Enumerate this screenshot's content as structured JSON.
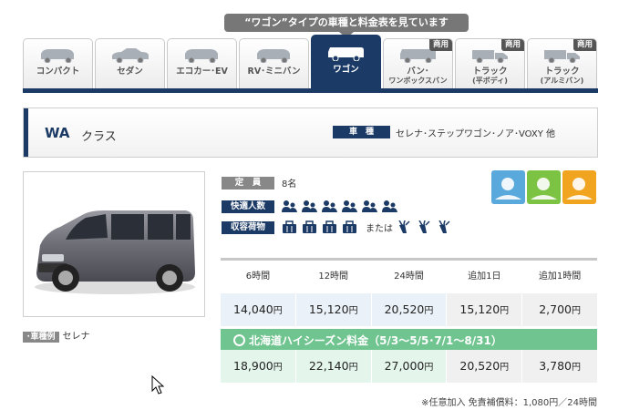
{
  "banner": "“ワゴン”タイプの車種と料金表を見ています",
  "tabs": [
    {
      "label": "コンパクト",
      "sub": "",
      "biz": "",
      "active": false,
      "icon": "compact-car-icon"
    },
    {
      "label": "セダン",
      "sub": "",
      "biz": "",
      "active": false,
      "icon": "sedan-icon"
    },
    {
      "label": "エコカー･EV",
      "sub": "",
      "biz": "",
      "active": false,
      "icon": "eco-car-icon"
    },
    {
      "label": "RV･ミニバン",
      "sub": "",
      "biz": "",
      "active": false,
      "icon": "rv-icon"
    },
    {
      "label": "ワゴン",
      "sub": "",
      "biz": "",
      "active": true,
      "icon": "wagon-icon"
    },
    {
      "label": "バン･",
      "sub": "ワンボックスバン",
      "biz": "商用",
      "active": false,
      "icon": "van-icon"
    },
    {
      "label": "トラック",
      "sub": "(平ボディ)",
      "biz": "商用",
      "active": false,
      "icon": "truck-flat-icon"
    },
    {
      "label": "トラック",
      "sub": "(アルミバン)",
      "biz": "商用",
      "active": false,
      "icon": "truck-aluminum-icon"
    }
  ],
  "class_header": {
    "code": "WA",
    "name": "クラス",
    "type_label": "車　種",
    "models": "セレナ･ステップワゴン･ノア･VOXY 他"
  },
  "example": {
    "label": "･車種例",
    "value": "セレナ"
  },
  "specs": {
    "capacity_label": "定　員",
    "capacity_value": "8名",
    "comfort_label": "快適人数",
    "comfort_count": 6,
    "cargo_label": "収容荷物",
    "cargo_count": 4,
    "cargo_or": "または",
    "golf_count": 3
  },
  "feature_icons": [
    {
      "name": "long-drive-icon",
      "color": "#5aa9dd"
    },
    {
      "name": "golf-icon",
      "color": "#7cc243"
    },
    {
      "name": "group-icon",
      "color": "#f0a41f"
    }
  ],
  "price_table": {
    "headers": [
      "6時間",
      "12時間",
      "24時間",
      "追加1日",
      "追加1時間"
    ],
    "regular": [
      "14,040",
      "15,120",
      "20,520",
      "15,120",
      "2,700"
    ],
    "season_label": "北海道ハイシーズン料金（5/3～5/5･7/1～8/31）",
    "season": [
      "18,900",
      "22,140",
      "27,000",
      "20,520",
      "3,780"
    ],
    "unit": "円"
  },
  "footnote": "※任意加入 免責補償料：1,080円／24時間",
  "colors": {
    "navy": "#1b3a66",
    "season_green": "#6fc48f"
  }
}
